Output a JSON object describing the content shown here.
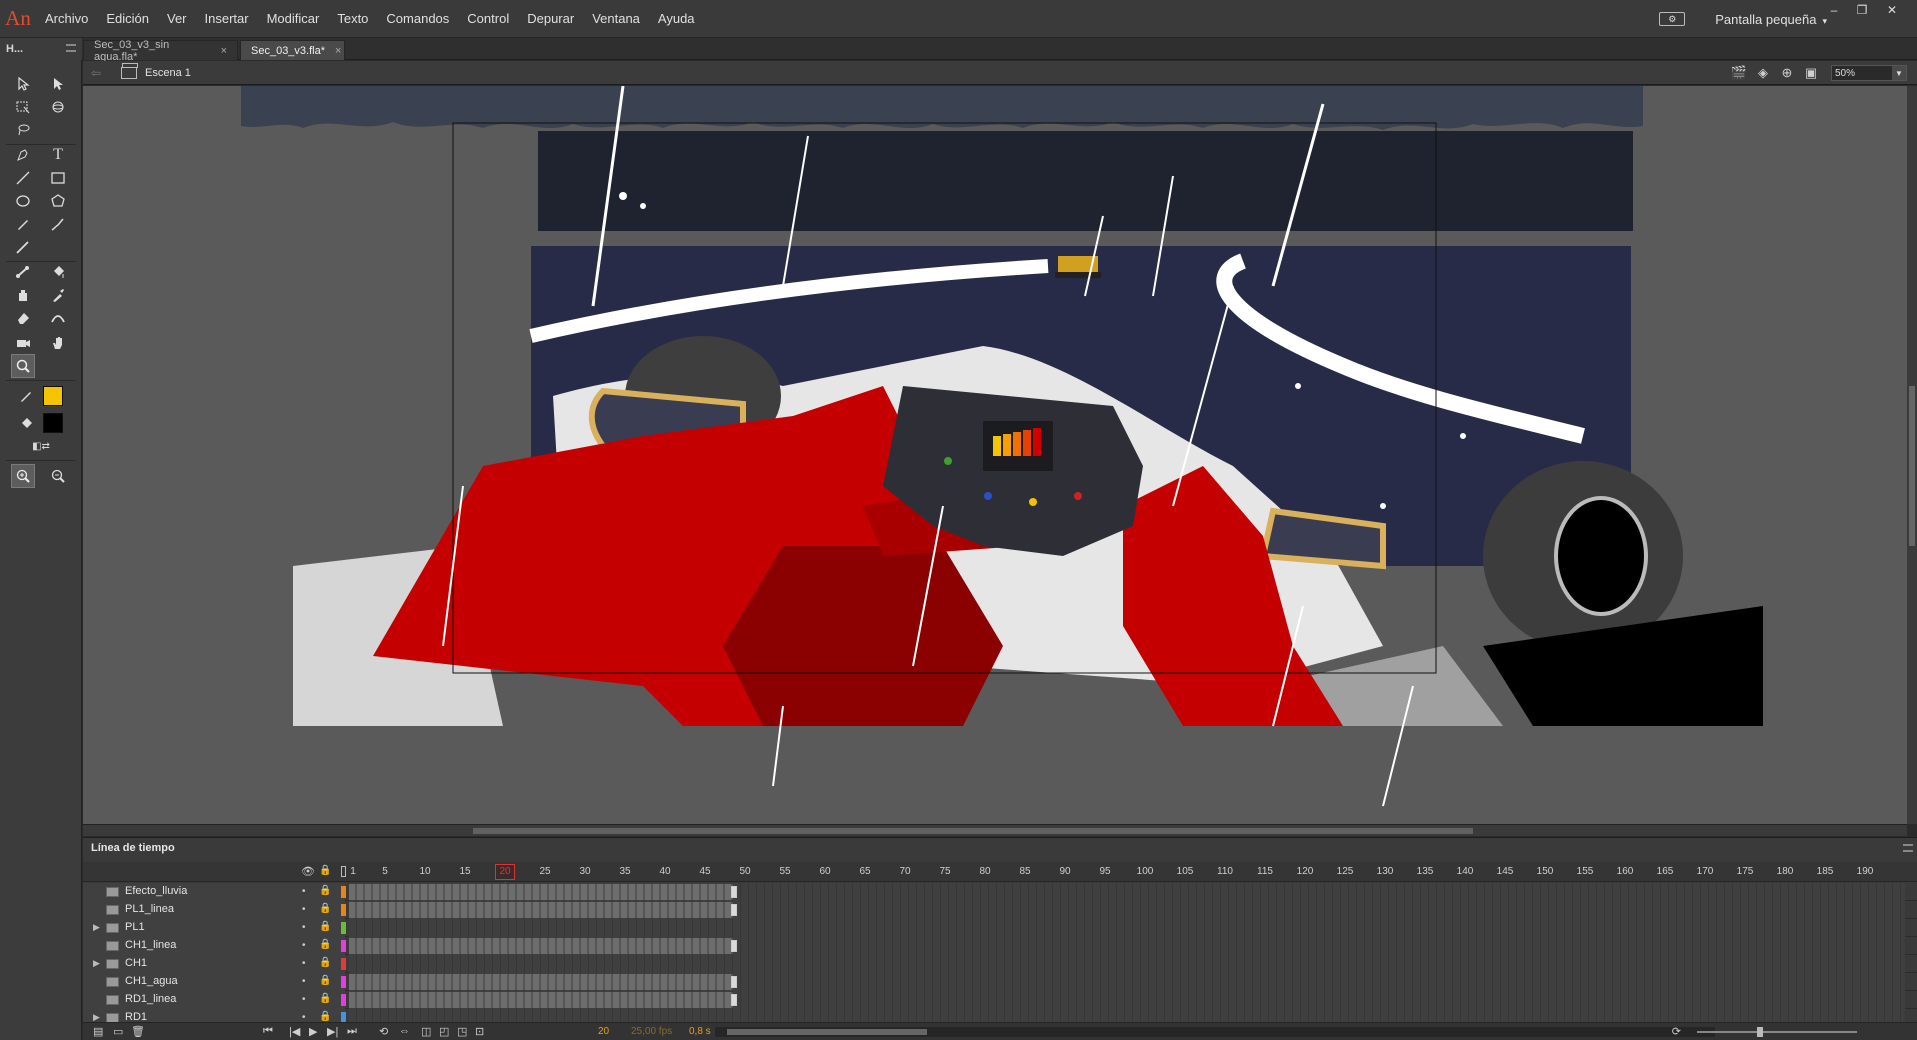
{
  "app": {
    "logo": "An",
    "accent": "#e84b2a"
  },
  "menu": [
    "Archivo",
    "Edición",
    "Ver",
    "Insertar",
    "Modificar",
    "Texto",
    "Comandos",
    "Control",
    "Depurar",
    "Ventana",
    "Ayuda"
  ],
  "workspace": {
    "label": "Pantalla pequeña",
    "caret": "▾"
  },
  "panel": {
    "header": "H..."
  },
  "tabs": [
    {
      "label": "Sec_03_v3_sin agua.fla*",
      "close": "×",
      "active": false
    },
    {
      "label": "Sec_03_v3.fla*",
      "close": "×",
      "active": true
    }
  ],
  "editbar": {
    "scene": "Escena 1",
    "zoom": "50%"
  },
  "toolbar": {
    "tools": [
      "selection-icon",
      "subselection-icon",
      "free-transform-icon",
      "3d-rotation-icon",
      "lasso-icon",
      "pen-icon",
      "text-icon",
      "line-icon",
      "rectangle-icon",
      "oval-icon",
      "polystar-icon",
      "pencil-icon",
      "brush-icon",
      "paint-brush-icon",
      "bone-icon",
      "paint-bucket-icon",
      "ink-bottle-icon",
      "eyedropper-icon",
      "eraser-icon",
      "width-icon",
      "camera-icon",
      "hand-icon",
      "zoom-icon"
    ],
    "stroke_color": "#f5c400",
    "fill_color": "#000000"
  },
  "timeline": {
    "title": "Línea de tiempo",
    "ruler": [
      1,
      5,
      10,
      15,
      20,
      25,
      30,
      35,
      40,
      45,
      50,
      55,
      60,
      65,
      70,
      75,
      80,
      85,
      90,
      95,
      100,
      105,
      110,
      115,
      120,
      125,
      130,
      135,
      140,
      145,
      150,
      155,
      160,
      165,
      170,
      175,
      180,
      185,
      190
    ],
    "playhead": "20",
    "current_frame": "20",
    "fps": "25,00 fps",
    "time": "0,8 s",
    "layers": [
      {
        "name": "Efecto_lluvia",
        "type": "layer",
        "color": "#e8841a",
        "frames": 48
      },
      {
        "name": "PL1_linea",
        "type": "layer",
        "color": "#e8841a",
        "frames": 48
      },
      {
        "name": "PL1",
        "type": "folder",
        "color": "#6cba3a",
        "frames": 0
      },
      {
        "name": "CH1_linea",
        "type": "layer",
        "color": "#e040e0",
        "frames": 48
      },
      {
        "name": "CH1",
        "type": "folder",
        "color": "#e03a3a",
        "frames": 0
      },
      {
        "name": "CH1_agua",
        "type": "layer",
        "color": "#e040e0",
        "frames": 48
      },
      {
        "name": "RD1_linea",
        "type": "layer",
        "color": "#e040e0",
        "frames": 48
      },
      {
        "name": "RD1",
        "type": "folder",
        "color": "#4a90e0",
        "frames": 0
      }
    ]
  }
}
